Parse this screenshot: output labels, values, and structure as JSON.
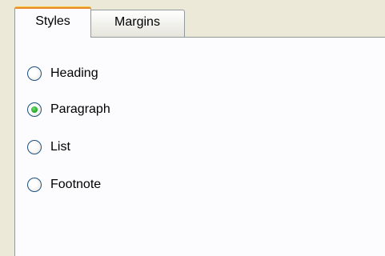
{
  "tabs": [
    {
      "label": "Styles",
      "active": true
    },
    {
      "label": "Margins",
      "active": false
    }
  ],
  "radio_options": [
    {
      "label": "Heading",
      "selected": false
    },
    {
      "label": "Paragraph",
      "selected": true
    },
    {
      "label": "List",
      "selected": false
    },
    {
      "label": "Footnote",
      "selected": false
    }
  ],
  "colors": {
    "tab_highlight": "#e68b2c",
    "border": "#919b9c",
    "panel": "#fcfcfe",
    "window": "#ece9d8",
    "radio_selected": "#21a121"
  }
}
